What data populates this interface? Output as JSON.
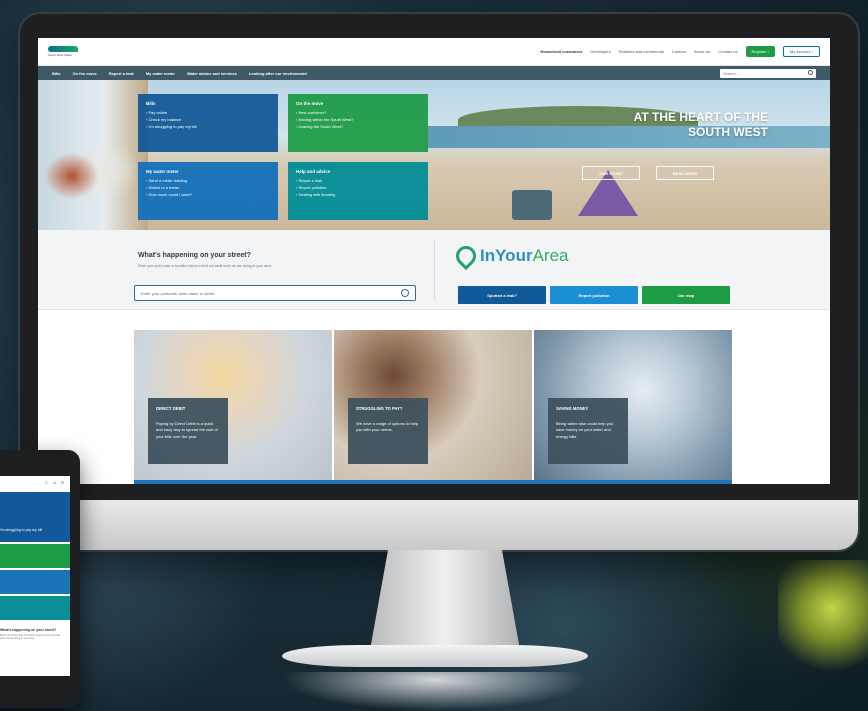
{
  "header": {
    "logo_text": "South West Water",
    "links": [
      "Household customers",
      "Developers",
      "Retailers and commercial",
      "Careers",
      "About Us",
      "Contact us"
    ],
    "register_label": "Register ›",
    "account_label": "My Account ›"
  },
  "nav": {
    "items": [
      "Bills",
      "On the move",
      "Report a leak",
      "My water meter",
      "Water advice and services",
      "Looking after our environment"
    ],
    "search_placeholder": "Search..."
  },
  "hero": {
    "heading_line1": "AT THE HEART OF THE",
    "heading_line2": "SOUTH WEST",
    "button1": "OUR STORY",
    "button2": "READ MORE",
    "tiles": {
      "bills": {
        "title": "Bills",
        "items": [
          "Pay online",
          "Check my balance",
          "I'm struggling to pay my bill"
        ]
      },
      "move": {
        "title": "On the move",
        "items": [
          "New customer?",
          "Moving within the South West?",
          "Leaving the South West?"
        ]
      },
      "meter": {
        "title": "My water meter",
        "items": [
          "Send a meter reading",
          "Switch to a meter",
          "How much could I save?"
        ]
      },
      "help": {
        "title": "Help and advice",
        "items": [
          "Report a leak",
          "Report pollution",
          "Dealing with flooding"
        ]
      }
    }
  },
  "street": {
    "title": "What's happening on your street?",
    "subtitle": "Enter your post code or location below to find out what work we are doing in your area.",
    "input_placeholder": "Enter your postcode, town name or street",
    "brand_in_your": "InYour",
    "brand_area": "Area",
    "buttons": [
      "Spotted a leak?",
      "Report pollution",
      "Our map"
    ]
  },
  "cards": [
    {
      "title": "DIRECT DEBIT",
      "body": "Paying by Direct Debit is a quick and easy way to spread the cost of your bills over the year."
    },
    {
      "title": "STRUGGLING TO PAY?",
      "body": "We have a range of options to help you with your needs."
    },
    {
      "title": "SAVING MONEY",
      "body": "Being water wise could help you save money on your water and energy bills."
    }
  ],
  "phone": {
    "bills_label": "I'm struggling to pay my bill",
    "street_title": "What's happening on your street?",
    "street_sub": "Enter your post code or location below to find out what work we are doing in your area."
  },
  "colors": {
    "nav_bg": "#3f5a66",
    "bills_tile": "#12589a",
    "move_tile": "#1e9b45",
    "meter_tile": "#116eb9",
    "help_tile": "#008c96",
    "brand_blue": "#2f8fc0",
    "brand_green": "#1fa56a"
  }
}
